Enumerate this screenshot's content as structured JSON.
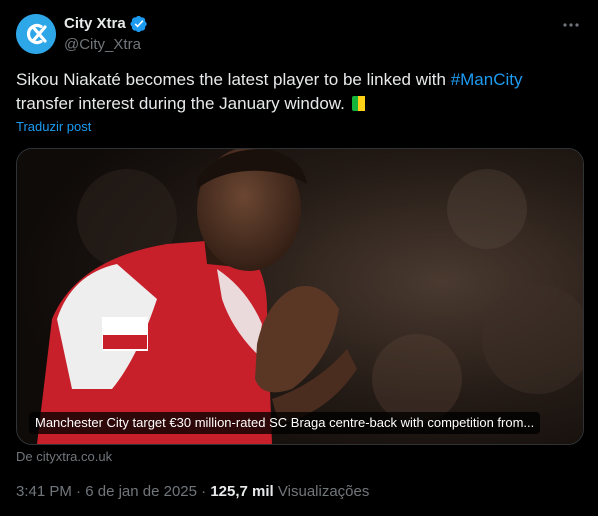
{
  "author": {
    "display_name": "City Xtra",
    "handle": "@City_Xtra",
    "avatar_color": "#2ea7e8",
    "verified_color": "#1d9bf0"
  },
  "tweet": {
    "text_before": "Sikou Niakaté becomes the latest player to be linked with ",
    "hashtag": "#ManCity",
    "text_after": " transfer interest during the January window.",
    "flag": "Mali flag"
  },
  "translate_label": "Traduzir post",
  "card": {
    "caption": "Manchester City target €30 million-rated SC Braga centre-back with competition from...",
    "source": "De cityxtra.co.uk",
    "image_description_icon": "football-player-photo"
  },
  "meta": {
    "time": "3:41 PM",
    "date": "6 de jan de 2025",
    "separator": "·",
    "views_count": "125,7 mil",
    "views_label": "Visualizações"
  },
  "colors": {
    "background": "#000000",
    "text": "#e7e9ea",
    "muted": "#71767b",
    "link": "#1d9bf0"
  }
}
